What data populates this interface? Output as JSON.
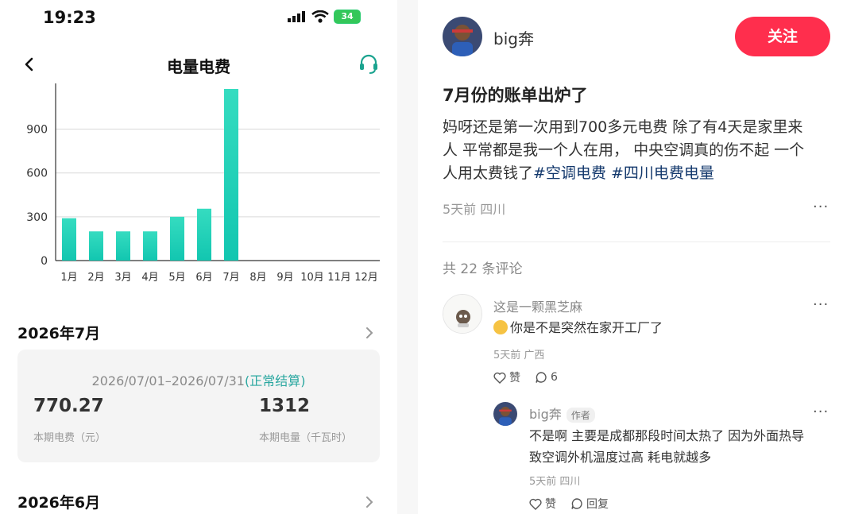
{
  "phone": {
    "status_time": "19:23",
    "battery": "34",
    "nav_title": "电量电费",
    "chart_data": {
      "type": "bar",
      "categories": [
        "1月",
        "2月",
        "3月",
        "4月",
        "5月",
        "6月",
        "7月",
        "8月",
        "9月",
        "10月",
        "11月",
        "12月"
      ],
      "values": [
        290,
        200,
        200,
        200,
        300,
        355,
        1175,
        null,
        null,
        null,
        null,
        null
      ],
      "yticks": [
        "0",
        "300",
        "600",
        "900"
      ],
      "ylim": [
        0,
        1175
      ],
      "grid": true,
      "bar_color": "#2fd3b8"
    },
    "july": {
      "title": "2026年7月",
      "period": "2026/07/01–2026/07/31",
      "status": "(正常结算)",
      "fee_value": "770.27",
      "fee_label": "本期电费（元）",
      "usage_value": "1312",
      "usage_label": "本期电量（千瓦时）"
    },
    "june": {
      "title": "2026年6月"
    }
  },
  "post": {
    "author": "big奔",
    "follow_label": "关注",
    "title": "7月份的账单出炉了",
    "body_lines": [
      "妈呀还是第一次用到700多元电费 除了有4天是家里来",
      "人 平常都是我一个人在用， 中央空调真的伤不起 一个",
      "人用太费钱了"
    ],
    "tags": [
      "#空调电费",
      "#四川电费电量"
    ],
    "meta": "5天前 四川",
    "comment_count": "共 22 条评论",
    "comments": [
      {
        "name": "这是一颗黑芝麻",
        "text": "你是不是突然在家开工厂了",
        "meta": "5天前 广西",
        "like_label": "赞",
        "reply_count": "6"
      }
    ],
    "reply": {
      "name": "big奔",
      "badge": "作者",
      "text_lines": [
        "不是啊 主要是成都那段时间太热了 因为外面热导",
        "致空调外机温度过高 耗电就越多"
      ],
      "meta": "5天前 四川",
      "like_label": "赞",
      "reply_label": "回复"
    },
    "accent_color": "#ff2e4d",
    "tag_color": "#13386c"
  }
}
